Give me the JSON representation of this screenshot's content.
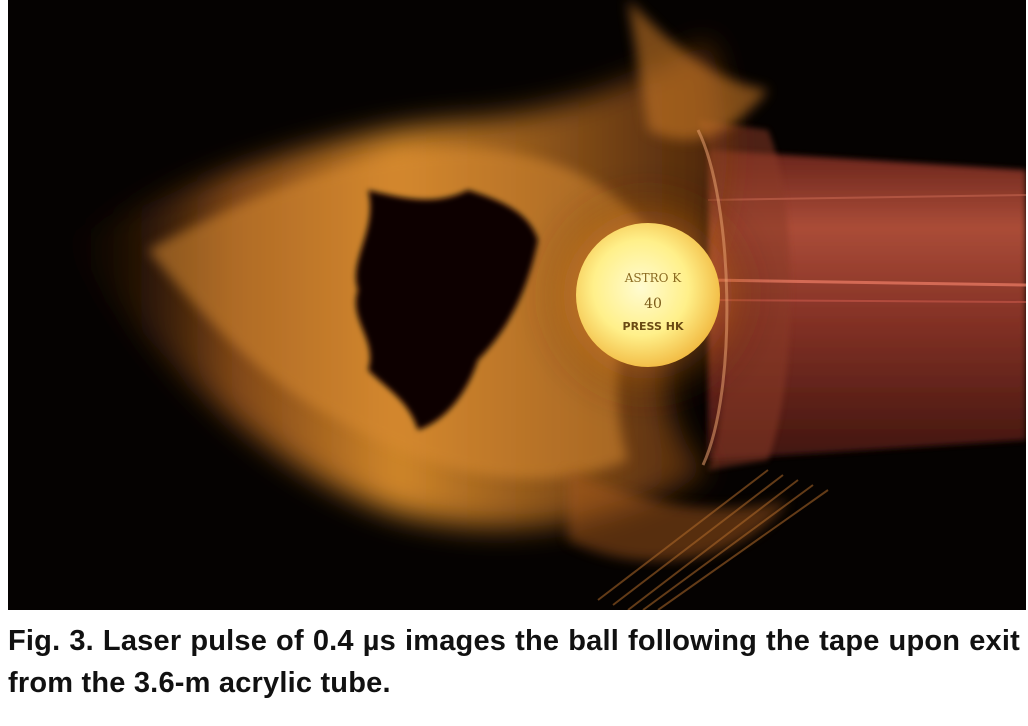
{
  "figure": {
    "caption": "Fig. 3. Laser pulse of 0.4 µs images the ball following the tape upon exit from the 3.6-m acrylic tube.",
    "ball_text": [
      "ASTRO K",
      "40",
      "PRESS HK"
    ],
    "colors": {
      "background": "#000000",
      "smoke": "#e8962e",
      "ball": "#fff6a0",
      "tube": "#b84a35"
    }
  }
}
